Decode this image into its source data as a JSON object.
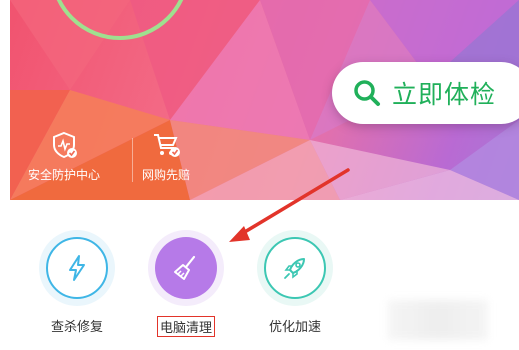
{
  "banner": {
    "check_button": {
      "label": "立即体检",
      "icon": "search-icon",
      "color": "#20b05a"
    },
    "security_items": [
      {
        "label": "安全防护中心",
        "icon": "shield-check-icon"
      },
      {
        "label": "网购先赔",
        "icon": "shopping-cart-check-icon"
      }
    ]
  },
  "tools": [
    {
      "label": "查杀修复",
      "icon": "lightning-icon",
      "color": "#3fb6e6"
    },
    {
      "label": "电脑清理",
      "icon": "broom-icon",
      "color": "#b67ae8",
      "highlighted": true
    },
    {
      "label": "优化加速",
      "icon": "rocket-icon",
      "color": "#3cc7b3"
    }
  ],
  "annotation": {
    "arrow_color": "#e2342a"
  }
}
